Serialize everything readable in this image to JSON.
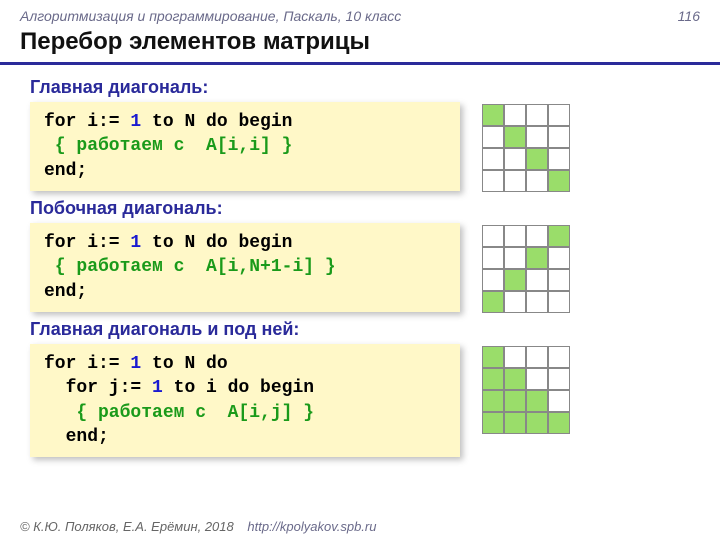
{
  "header": {
    "course": "Алгоритмизация и программирование, Паскаль, 10 класс",
    "page": "116"
  },
  "title": "Перебор элементов матрицы",
  "sections": {
    "s1": {
      "label": "Главная диагональ:",
      "code": {
        "l1a": "for i:= ",
        "l1b": "1",
        "l1c": " to N do begin",
        "l2": " { работаем с  A[i,i] }",
        "l3": "end;"
      },
      "grid": [
        [
          1,
          0,
          0,
          0
        ],
        [
          0,
          1,
          0,
          0
        ],
        [
          0,
          0,
          1,
          0
        ],
        [
          0,
          0,
          0,
          1
        ]
      ]
    },
    "s2": {
      "label": "Побочная диагональ:",
      "code": {
        "l1a": "for i:= ",
        "l1b": "1",
        "l1c": " to N do begin",
        "l2": " { работаем с  A[i,N+1-i] }",
        "l3": "end;"
      },
      "grid": [
        [
          0,
          0,
          0,
          1
        ],
        [
          0,
          0,
          1,
          0
        ],
        [
          0,
          1,
          0,
          0
        ],
        [
          1,
          0,
          0,
          0
        ]
      ]
    },
    "s3": {
      "label": "Главная диагональ и под ней:",
      "code": {
        "l1a": "for i:= ",
        "l1b": "1",
        "l1c": " to N do",
        "l2a": "  for j:= ",
        "l2b": "1",
        "l2c": " to i do begin",
        "l3": "   { работаем с  A[i,j] }",
        "l4": "  end;"
      },
      "grid": [
        [
          1,
          0,
          0,
          0
        ],
        [
          1,
          1,
          0,
          0
        ],
        [
          1,
          1,
          1,
          0
        ],
        [
          1,
          1,
          1,
          1
        ]
      ]
    }
  },
  "footer": {
    "copyright": "© К.Ю. Поляков, Е.А. Ерёмин, 2018",
    "url": "http://kpolyakov.spb.ru"
  }
}
